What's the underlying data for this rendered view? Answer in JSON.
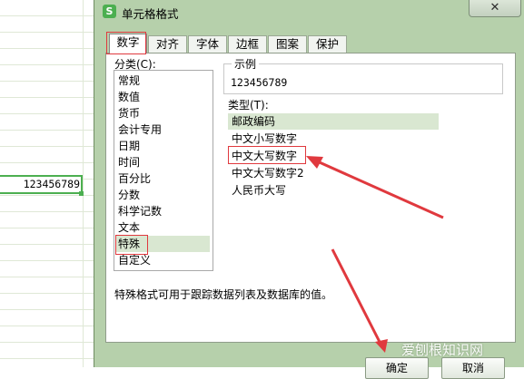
{
  "sheet": {
    "cell_value": "123456789"
  },
  "dialog": {
    "title": "单元格格式",
    "app_icon": "S",
    "close_symbol": "✕",
    "tabs": [
      "数字",
      "对齐",
      "字体",
      "边框",
      "图案",
      "保护"
    ],
    "category_label": "分类(C):",
    "categories": [
      "常规",
      "数值",
      "货币",
      "会计专用",
      "日期",
      "时间",
      "百分比",
      "分数",
      "科学记数",
      "文本",
      "特殊",
      "自定义"
    ],
    "selected_category": "特殊",
    "sample_label": "示例",
    "sample_value": "123456789",
    "type_label": "类型(T):",
    "types": [
      "邮政编码",
      "中文小写数字",
      "中文大写数字",
      "中文大写数字2",
      "人民币大写"
    ],
    "selected_type": "邮政编码",
    "description": "特殊格式可用于跟踪数据列表及数据库的值。",
    "ok_label": "确定",
    "cancel_label": "取消"
  },
  "watermark": "爱刨根知识网",
  "colors": {
    "annotation": "#e0393e",
    "dialog_bg": "#b6d0ab",
    "selection": "#d9e7d1",
    "cell_border": "#4caf50"
  }
}
